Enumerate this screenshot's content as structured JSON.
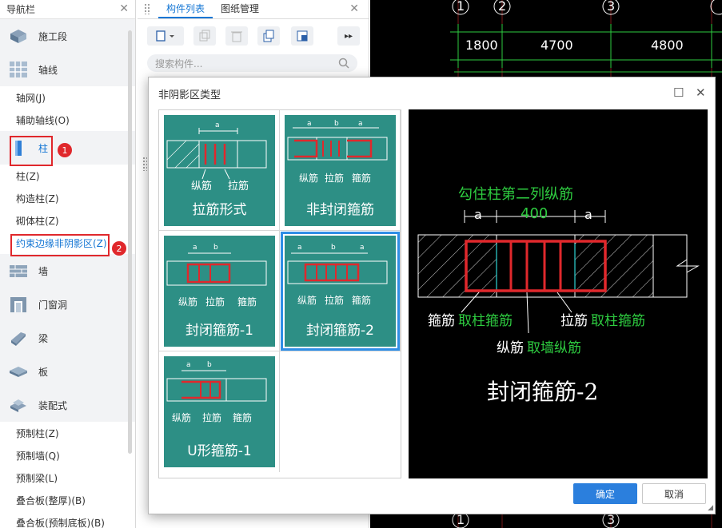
{
  "nav": {
    "title": "导航栏",
    "categories": {
      "construction_segment": "施工段",
      "axis": "轴线",
      "column": "柱",
      "wall": "墙",
      "door_window": "门窗洞",
      "beam": "梁",
      "slab": "板",
      "prefab": "装配式"
    },
    "axis_items": [
      "轴网(J)",
      "辅助轴线(O)"
    ],
    "column_items": [
      "柱(Z)",
      "构造柱(Z)",
      "砌体柱(Z)",
      "约束边缘非阴影区(Z)"
    ],
    "prefab_items": [
      "预制柱(Z)",
      "预制墙(Q)",
      "预制梁(L)",
      "叠合板(整厚)(B)",
      "叠合板(预制底板)(B)"
    ],
    "badges": [
      "1",
      "2"
    ]
  },
  "panel": {
    "tabs": [
      "构件列表",
      "图纸管理"
    ],
    "search_placeholder": "搜索构件..."
  },
  "cad": {
    "axis_top": [
      "1",
      "2",
      "3"
    ],
    "axis_bottom": [
      "1",
      "3"
    ],
    "dims": [
      "1800",
      "4700",
      "4800"
    ]
  },
  "dialog": {
    "title": "非阴影区类型",
    "options": [
      {
        "label": "拉筋形式",
        "annot": [
          "a",
          "纵筋",
          "拉筋"
        ]
      },
      {
        "label": "非封闭箍筋",
        "annot": [
          "a",
          "b",
          "a",
          "纵筋",
          "拉筋",
          "箍筋"
        ]
      },
      {
        "label": "封闭箍筋-1",
        "annot": [
          "a",
          "b",
          "纵筋",
          "拉筋",
          "箍筋"
        ]
      },
      {
        "label": "封闭箍筋-2",
        "annot": [
          "a",
          "b",
          "a",
          "纵筋",
          "拉筋",
          "箍筋"
        ]
      },
      {
        "label": "U形箍筋-1",
        "annot": [
          "a",
          "b",
          "纵筋",
          "拉筋",
          "箍筋"
        ]
      }
    ],
    "selected": "封闭箍筋-2",
    "preview": {
      "top_note": "勾住柱第二列纵筋",
      "dim_a": "a",
      "dim_400": "400",
      "stirrup_w": "箍筋",
      "stirrup_g": "取柱箍筋",
      "tie_w": "拉筋",
      "tie_g": "取柱箍筋",
      "long_w": "纵筋",
      "long_g": "取墙纵筋",
      "name": "封闭箍筋-2"
    },
    "ok": "确定",
    "cancel": "取消"
  },
  "colors": {
    "accent": "#1476d4",
    "card": "#2d8f85",
    "mark": "#e0282c",
    "cad_green": "#2ecc40"
  }
}
